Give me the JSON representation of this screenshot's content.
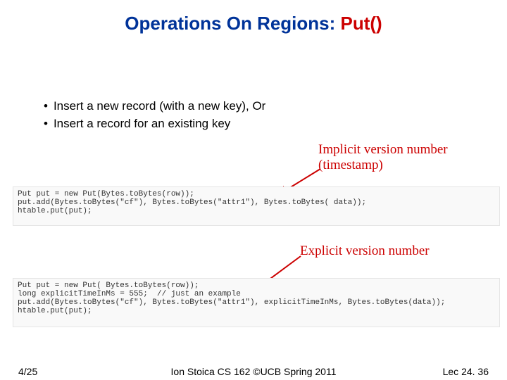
{
  "title": {
    "main": "Operations On Regions: ",
    "accent": "Put()"
  },
  "bullets": [
    "Insert a new record (with a new key), Or",
    "Insert a record for an existing key"
  ],
  "notes": {
    "implicit_l1": "Implicit version number",
    "implicit_l2": "(timestamp)",
    "explicit": "Explicit version number"
  },
  "code": {
    "block1": "Put put = new Put(Bytes.toBytes(row));\nput.add(Bytes.toBytes(\"cf\"), Bytes.toBytes(\"attr1\"), Bytes.toBytes( data));\nhtable.put(put);",
    "block2": "Put put = new Put( Bytes.toBytes(row));\nlong explicitTimeInMs = 555;  // just an example\nput.add(Bytes.toBytes(\"cf\"), Bytes.toBytes(\"attr1\"), explicitTimeInMs, Bytes.toBytes(data));\nhtable.put(put);"
  },
  "footer": {
    "left": "4/25",
    "center": "Ion Stoica CS 162 ©UCB Spring 2011",
    "right": "Lec 24. 36"
  }
}
